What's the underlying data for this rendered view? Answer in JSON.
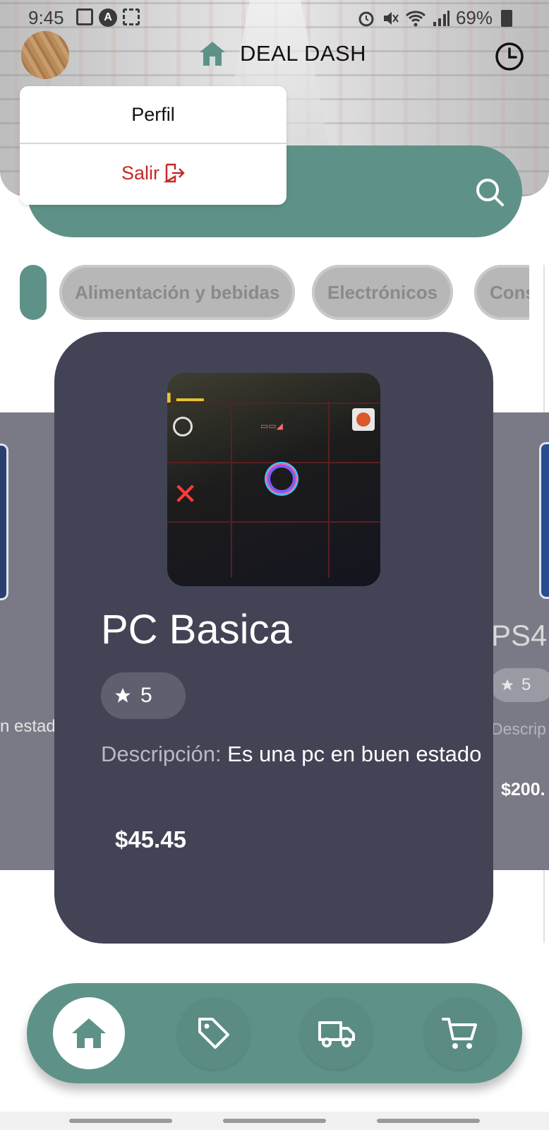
{
  "status_bar": {
    "time": "9:45",
    "battery": "69%"
  },
  "header": {
    "title": "DEAL DASH"
  },
  "menu": {
    "profile_label": "Perfil",
    "logout_label": "Salir"
  },
  "categories": [
    "Alimentación y bebidas",
    "Electrónicos",
    "Cons"
  ],
  "side_left": {
    "description_fragment": "n estado"
  },
  "side_right": {
    "name_fragment": "PS4",
    "rating": "5",
    "description_fragment": "Descrip",
    "price_fragment": "$200."
  },
  "product": {
    "name": "PC Basica",
    "rating": "5",
    "description_label": "Descripción:",
    "description": " Es una pc en buen estado",
    "price": "$45.45"
  },
  "colors": {
    "accent": "#5e9288",
    "card": "#434356",
    "logout": "#c62828"
  },
  "nav": {
    "items": [
      "home-icon",
      "tag-icon",
      "truck-icon",
      "cart-icon"
    ],
    "active": "home-icon"
  }
}
